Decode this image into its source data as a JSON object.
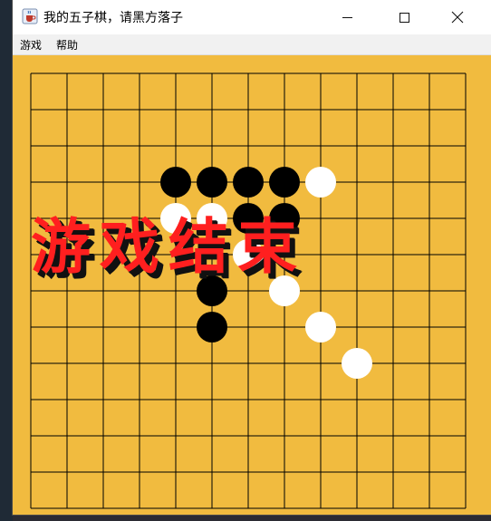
{
  "window": {
    "title": "我的五子棋，请黑方落子",
    "icon": "java-cup-icon",
    "controls": {
      "minimize": "minimize-icon",
      "maximize": "maximize-icon",
      "close": "close-icon"
    }
  },
  "menu": {
    "items": [
      {
        "label": "游戏"
      },
      {
        "label": "帮助"
      }
    ]
  },
  "board": {
    "grid_size": 13,
    "background_color": "#f1bb3f",
    "line_color": "#000000",
    "black_color": "#000000",
    "white_color": "#ffffff",
    "stones": [
      {
        "col": 4,
        "row": 3,
        "color": "black"
      },
      {
        "col": 5,
        "row": 3,
        "color": "black"
      },
      {
        "col": 6,
        "row": 3,
        "color": "black"
      },
      {
        "col": 7,
        "row": 3,
        "color": "black"
      },
      {
        "col": 8,
        "row": 3,
        "color": "white"
      },
      {
        "col": 4,
        "row": 4,
        "color": "white"
      },
      {
        "col": 5,
        "row": 4,
        "color": "white"
      },
      {
        "col": 6,
        "row": 4,
        "color": "black"
      },
      {
        "col": 7,
        "row": 4,
        "color": "black"
      },
      {
        "col": 6,
        "row": 5,
        "color": "white"
      },
      {
        "col": 5,
        "row": 6,
        "color": "black"
      },
      {
        "col": 7,
        "row": 6,
        "color": "white"
      },
      {
        "col": 5,
        "row": 7,
        "color": "black"
      },
      {
        "col": 8,
        "row": 7,
        "color": "white"
      },
      {
        "col": 9,
        "row": 8,
        "color": "white"
      }
    ]
  },
  "overlay": {
    "text": "游戏结束",
    "color": "#ff1f1f",
    "shadow_color": "#111111"
  }
}
